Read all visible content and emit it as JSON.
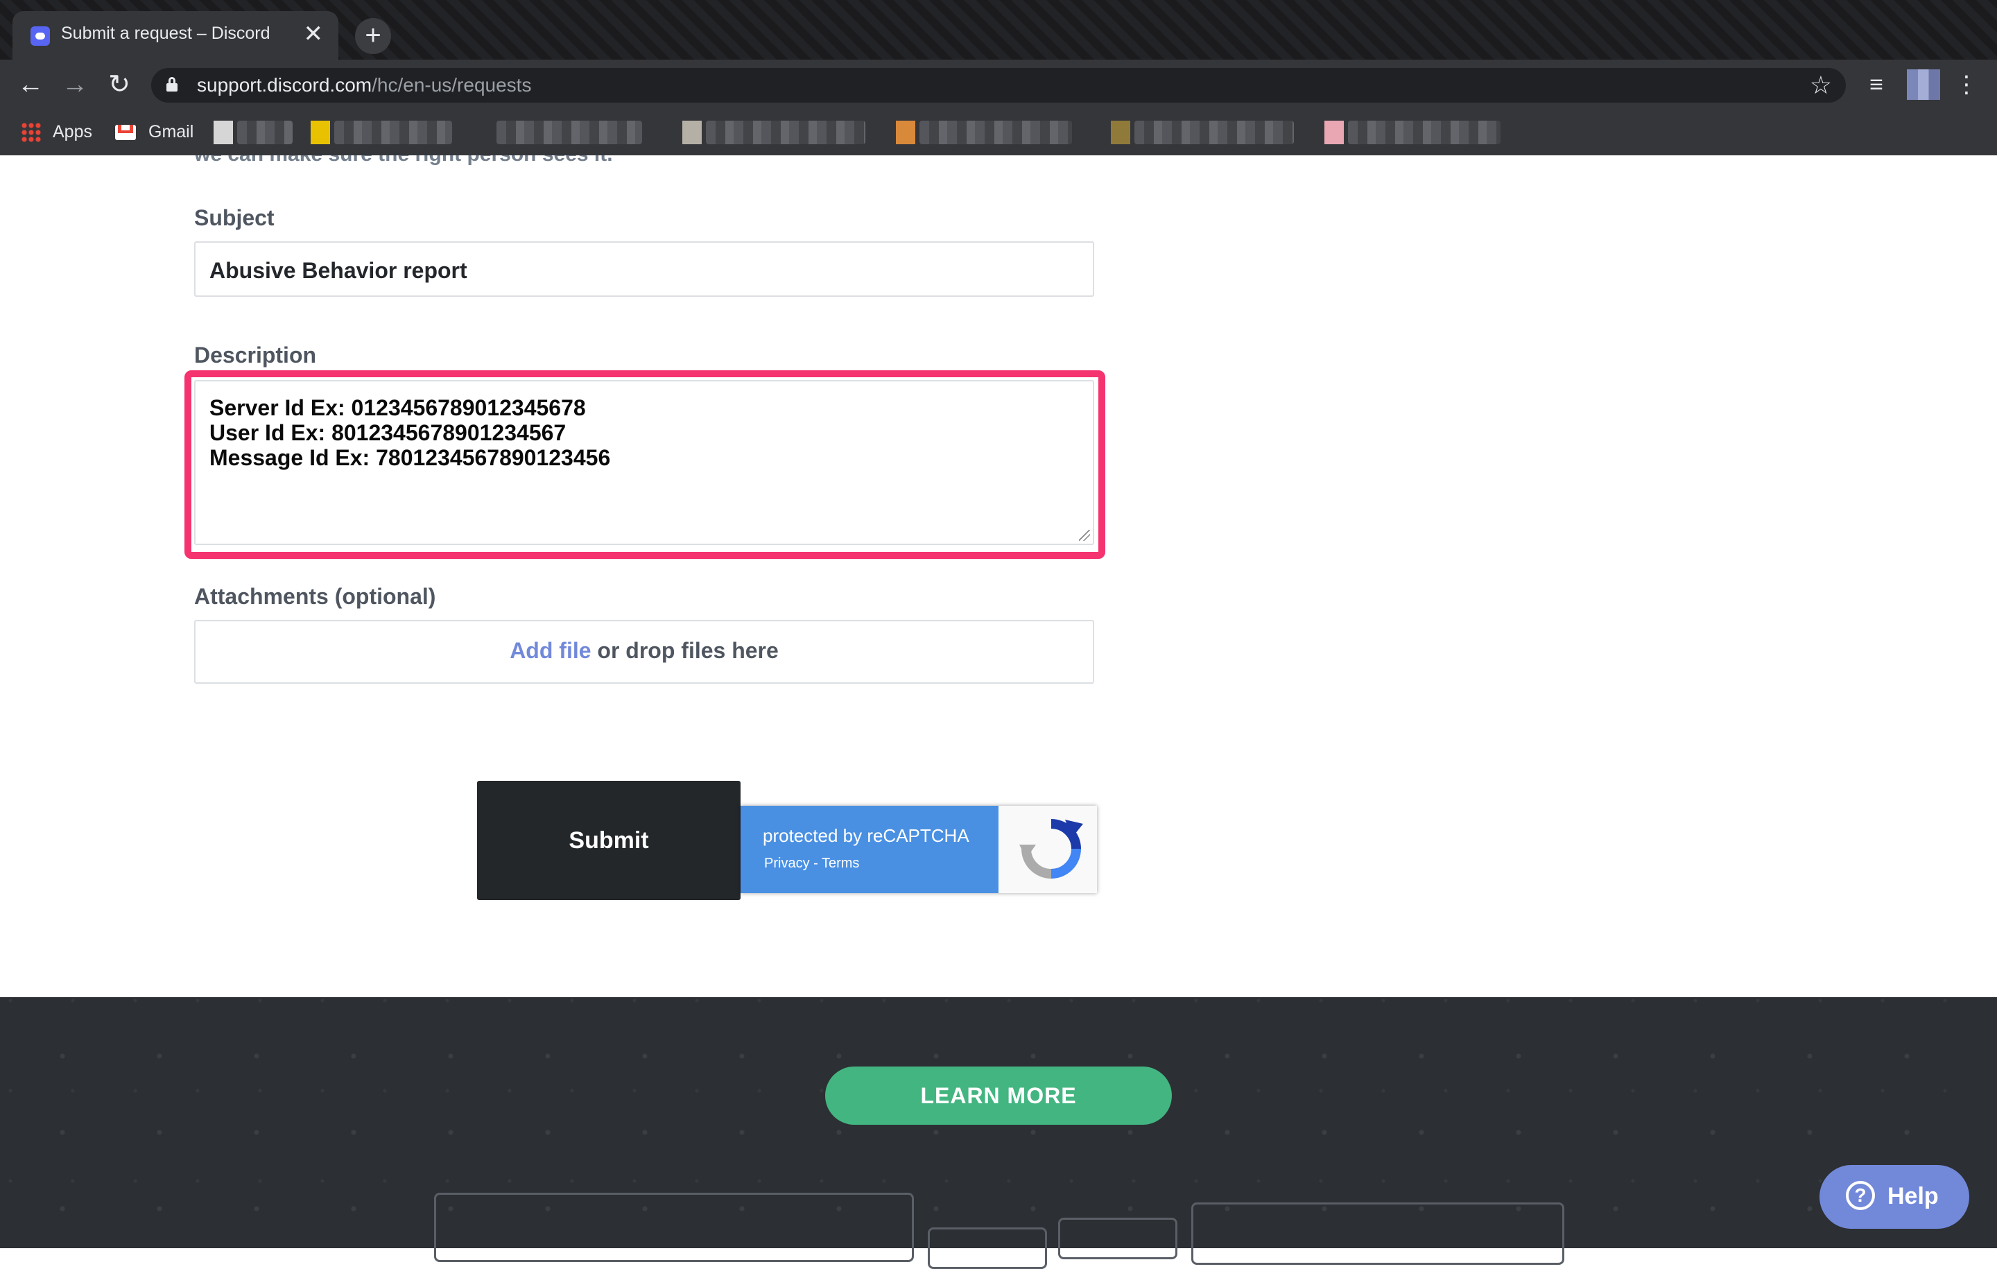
{
  "browser": {
    "tab_title": "Submit a request – Discord",
    "tab_close": "✕",
    "new_tab": "+",
    "url_domain": "support.discord.com",
    "url_path": "/hc/en-us/requests",
    "bookmarks": {
      "apps": "Apps",
      "gmail": "Gmail"
    }
  },
  "form": {
    "cutoff_text": "we can make sure the right person sees it.",
    "subject_label": "Subject",
    "subject_value": "Abusive Behavior report",
    "description_label": "Description",
    "description_lines": [
      "Server Id Ex: 0123456789012345678",
      "User Id Ex: 8012345678901234567",
      "Message Id Ex: 7801234567890123456"
    ],
    "attachments_label": "Attachments (optional)",
    "add_file": "Add file",
    "drop_text": " or drop files here",
    "submit_label": "Submit",
    "recaptcha_main": "protected by reCAPTCHA",
    "recaptcha_sub": "Privacy - Terms"
  },
  "footer": {
    "learn_more": "LEARN MORE"
  },
  "help_widget": {
    "label": "Help",
    "icon": "?"
  },
  "colors": {
    "highlight": "#f4336f",
    "link": "#7289da",
    "learn_more": "#43b581",
    "submit_bg": "#23272a",
    "recaptcha_blue": "#4a90e2"
  }
}
